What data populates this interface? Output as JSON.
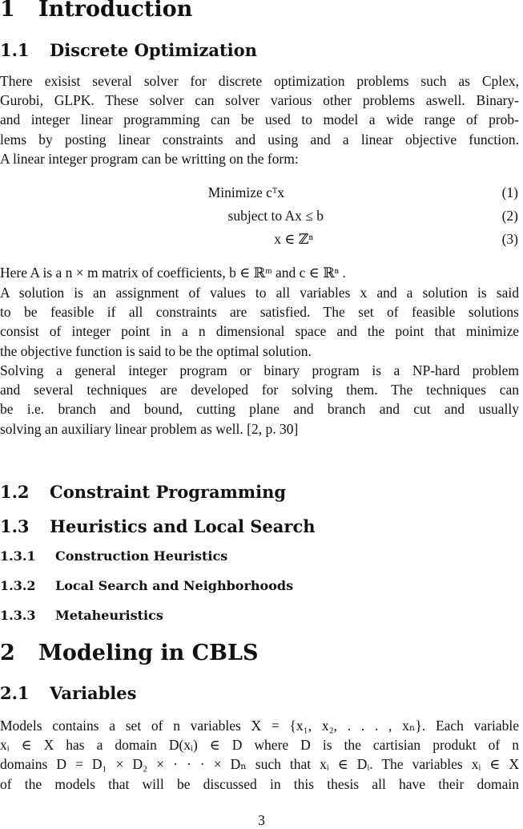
{
  "sections": {
    "s1": {
      "num": "1",
      "title": "Introduction"
    },
    "s1_1": {
      "num": "1.1",
      "title": "Discrete Optimization"
    },
    "s1_2": {
      "num": "1.2",
      "title": "Constraint Programming"
    },
    "s1_3": {
      "num": "1.3",
      "title": "Heuristics and Local Search"
    },
    "s1_3_1": {
      "num": "1.3.1",
      "title": "Construction Heuristics"
    },
    "s1_3_2": {
      "num": "1.3.2",
      "title": "Local Search and Neighborhoods"
    },
    "s1_3_3": {
      "num": "1.3.3",
      "title": "Metaheuristics"
    },
    "s2": {
      "num": "2",
      "title": "Modeling in CBLS"
    },
    "s2_1": {
      "num": "2.1",
      "title": "Variables"
    }
  },
  "para_intro": [
    "There exisist several solver for discrete optimization problems such as Cplex,",
    "Gurobi, GLPK. These solver can solver various other problems aswell. Binary-",
    "and integer linear programming can be used to model a wide range of prob-",
    "lems by posting linear constraints and using and a linear objective function.",
    "A linear integer program can be writting on the form:"
  ],
  "equations": [
    {
      "text": "Minimize cᵀx",
      "number": "(1)"
    },
    {
      "text": "subject to Ax ≤ b",
      "number": "(2)"
    },
    {
      "text": "x ∈ ℤⁿ",
      "number": "(3)"
    }
  ],
  "para_here": [
    "Here A is a n × m matrix of coefficients, b ∈ ℝᵐ and c ∈ ℝⁿ ."
  ],
  "para_solution": [
    "A solution is an assignment of values to all variables x and a solution is said",
    "to be feasible if all constraints are satisfied.  The set of feasible solutions",
    "consist of integer point in a n dimensional space and the point that minimize",
    "the objective function is said to be the optimal solution."
  ],
  "para_solving": [
    "Solving a general integer program or binary program is a NP-hard problem",
    "and several techniques are developed for solving them.  The techniques can",
    "be i.e.  branch and bound, cutting plane and branch and cut and usually",
    "solving an auxiliary linear problem as well. [2, p. 30]"
  ],
  "para_models": [
    "Models contains a set of n variables X = {x₁, x₂, . . . , xₙ}.  Each variable",
    "xᵢ ∈ X has a domain D(xᵢ) ∈ D where D is the cartisian produkt of n",
    "domains D = D₁ × D₂ × · · · × Dₙ such that xᵢ ∈ Dᵢ. The variables xᵢ ∈ X",
    "of the models that will be discussed in this thesis all have their domain"
  ],
  "page_number": "3"
}
